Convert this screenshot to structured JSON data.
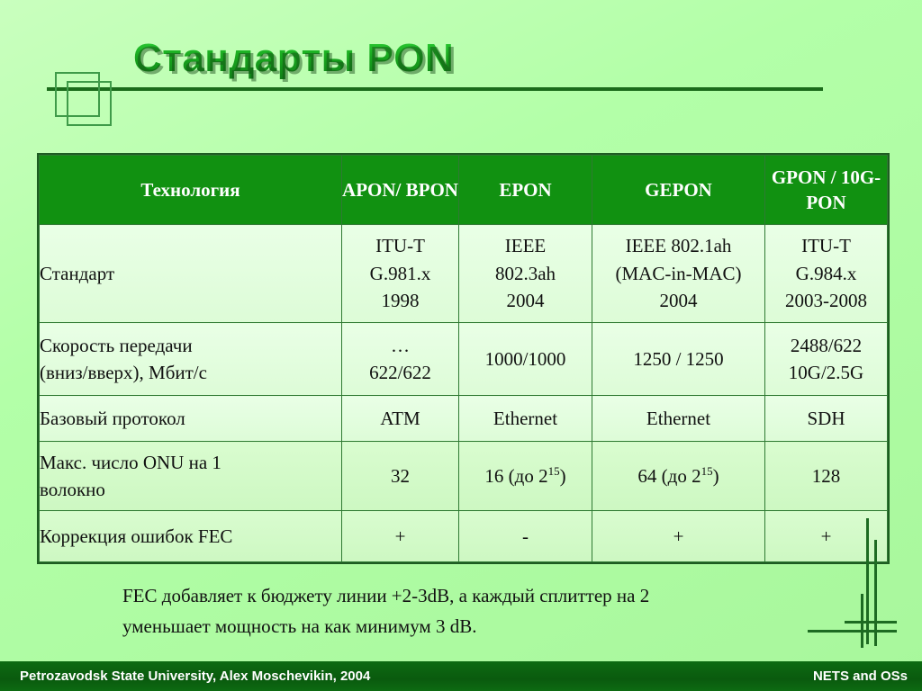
{
  "slide": {
    "title": "Стандарты PON",
    "background_color": "#b3ffa8",
    "accent_color": "#119111",
    "title_color": "#19a81f"
  },
  "table": {
    "headers": [
      {
        "label": "Технология"
      },
      {
        "line1": "APON/",
        "line2": "BPON"
      },
      {
        "line1": "EPON",
        "line2": ""
      },
      {
        "line1": "GEPON",
        "line2": ""
      },
      {
        "line1": "GPON /",
        "line2": "10G-PON"
      }
    ],
    "rows": [
      {
        "label": "Стандарт",
        "apon": {
          "l1": "ITU-T",
          "l2": "G.981.x",
          "l3": "1998"
        },
        "epon": {
          "l1": "IEEE",
          "l2": "802.3ah",
          "l3": "2004"
        },
        "gepon": {
          "l1": "IEEE 802.1ah",
          "l2": "(MAC-in-MAC)",
          "l3": "2004"
        },
        "gpon": {
          "l1": "ITU-T",
          "l2": "G.984.x",
          "l3": "2003-2008"
        }
      },
      {
        "label_l1": "Скорость передачи",
        "label_l2": "(вниз/вверх), Мбит/с",
        "apon": {
          "l1": "…",
          "l2": "622/622"
        },
        "epon": {
          "l1": "1000/1000",
          "l2": ""
        },
        "gepon": {
          "l1": "1250 / 1250",
          "l2": ""
        },
        "gpon": {
          "l1": "2488/622",
          "l2": "10G/2.5G"
        }
      },
      {
        "label": "Базовый протокол",
        "apon": "ATM",
        "epon": "Ethernet",
        "gepon": "Ethernet",
        "gpon": "SDH"
      },
      {
        "label_l1": "Макс. число ONU на 1",
        "label_l2": "волокно",
        "apon": "32",
        "epon_pre": "16 (до 2",
        "epon_sup": "15",
        "epon_post": ")",
        "gepon_pre": "64 (до 2",
        "gepon_sup": "15",
        "gepon_post": ")",
        "gpon": "128"
      },
      {
        "label": "Коррекция ошибок FEC",
        "apon": "+",
        "epon": "-",
        "gepon": "+",
        "gpon": "+"
      }
    ]
  },
  "footnote": {
    "line1": "FEC добавляет к бюджету линии +2-3dB, а каждый сплиттер на 2",
    "line2": "уменьшает мощность на как минимум 3 dB."
  },
  "footer": {
    "left": "Petrozavodsk State University, Alex Moschevikin, 2004",
    "right": "NETS and OSs"
  }
}
